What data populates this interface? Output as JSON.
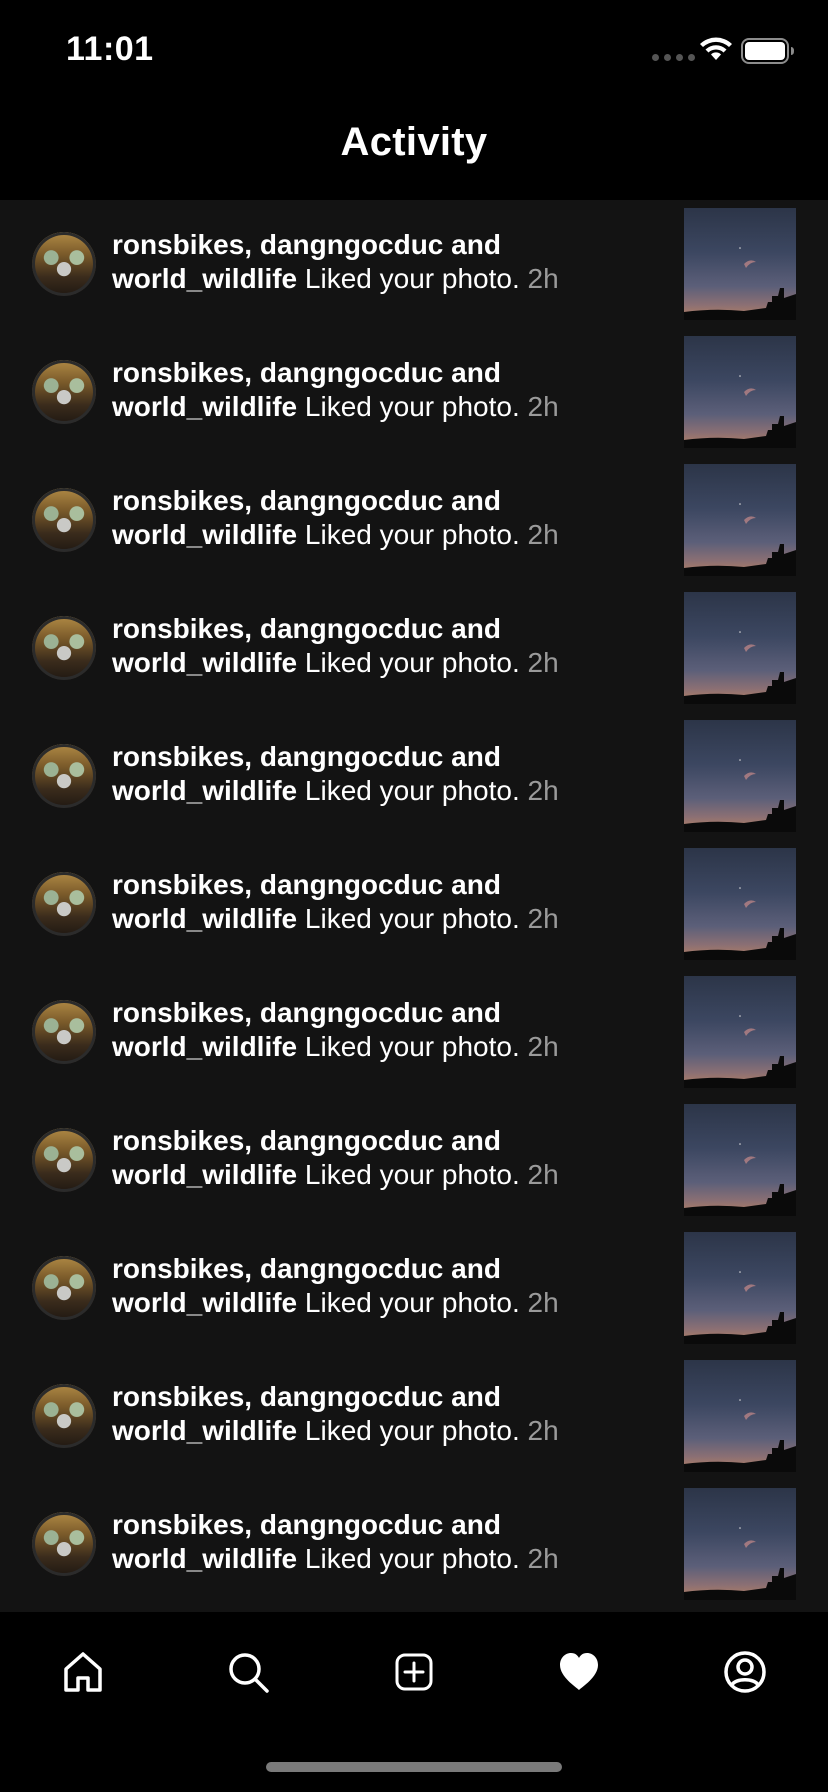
{
  "status_bar": {
    "time": "11:01",
    "icons": [
      "signal-icon",
      "wifi-icon",
      "battery-icon"
    ]
  },
  "header": {
    "title": "Activity"
  },
  "activity": {
    "items": [
      {
        "usernames": "ronsbikes, dangngocduc and world_wildlife",
        "action": "Liked your photo.",
        "time": "2h"
      },
      {
        "usernames": "ronsbikes, dangngocduc and world_wildlife",
        "action": "Liked your photo.",
        "time": "2h"
      },
      {
        "usernames": "ronsbikes, dangngocduc and world_wildlife",
        "action": "Liked your photo.",
        "time": "2h"
      },
      {
        "usernames": "ronsbikes, dangngocduc and world_wildlife",
        "action": "Liked your photo.",
        "time": "2h"
      },
      {
        "usernames": "ronsbikes, dangngocduc and world_wildlife",
        "action": "Liked your photo.",
        "time": "2h"
      },
      {
        "usernames": "ronsbikes, dangngocduc and world_wildlife",
        "action": "Liked your photo.",
        "time": "2h"
      },
      {
        "usernames": "ronsbikes, dangngocduc and world_wildlife",
        "action": "Liked your photo.",
        "time": "2h"
      },
      {
        "usernames": "ronsbikes, dangngocduc and world_wildlife",
        "action": "Liked your photo.",
        "time": "2h"
      },
      {
        "usernames": "ronsbikes, dangngocduc and world_wildlife",
        "action": "Liked your photo.",
        "time": "2h"
      },
      {
        "usernames": "ronsbikes, dangngocduc and world_wildlife",
        "action": "Liked your photo.",
        "time": "2h"
      },
      {
        "usernames": "ronsbikes, dangngocduc and world_wildlife",
        "action": "Liked your photo.",
        "time": "2h"
      }
    ]
  },
  "tab_bar": {
    "tabs": [
      {
        "icon": "home-icon",
        "selected": false
      },
      {
        "icon": "search-icon",
        "selected": false
      },
      {
        "icon": "add-post-icon",
        "selected": false
      },
      {
        "icon": "heart-icon",
        "selected": true
      },
      {
        "icon": "profile-icon",
        "selected": false
      }
    ]
  },
  "colors": {
    "background": "#000000",
    "list_background": "#131313",
    "text": "#ffffff",
    "secondary_text": "#9a9a9a"
  }
}
